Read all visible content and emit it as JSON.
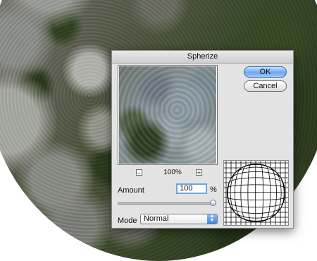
{
  "dialog": {
    "title": "Spherize",
    "ok_label": "OK",
    "cancel_label": "Cancel",
    "zoom": {
      "minus_label": "-",
      "value": "100%",
      "plus_label": "+"
    },
    "amount": {
      "label": "Amount",
      "value": "100",
      "unit": "%",
      "slider_fraction": 1.0
    },
    "mode": {
      "label": "Mode",
      "selected": "Normal"
    }
  },
  "colors": {
    "ok_accent": "#6ea8ef",
    "field_focus": "#6fa3e6",
    "dialog_bg": "#e3e3e3"
  },
  "icons": {
    "select_arrows": "up-down-arrows-icon",
    "grid": "sphere-grid-icon"
  }
}
